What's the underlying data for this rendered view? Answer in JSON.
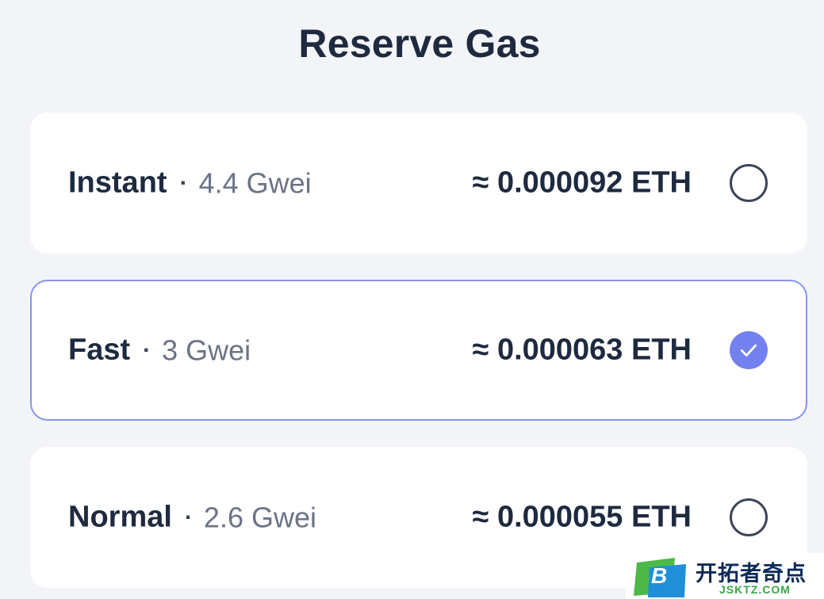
{
  "title": "Reserve Gas",
  "options": [
    {
      "name": "Instant",
      "separator": "·",
      "gwei": "4.4 Gwei",
      "eth": "≈ 0.000092 ETH",
      "selected": false
    },
    {
      "name": "Fast",
      "separator": "·",
      "gwei": "3 Gwei",
      "eth": "≈ 0.000063 ETH",
      "selected": true
    },
    {
      "name": "Normal",
      "separator": "·",
      "gwei": "2.6 Gwei",
      "eth": "≈ 0.000055 ETH",
      "selected": false
    }
  ],
  "colors": {
    "background": "#f2f4f8",
    "card": "#ffffff",
    "text_primary": "#1e2a3f",
    "text_secondary": "#6b7385",
    "accent": "#7381ef",
    "selected_border": "#8894ee"
  },
  "watermark": {
    "logo_letter": "B",
    "text_cn": "开拓者奇点",
    "text_en": "JSKTZ.COM"
  }
}
